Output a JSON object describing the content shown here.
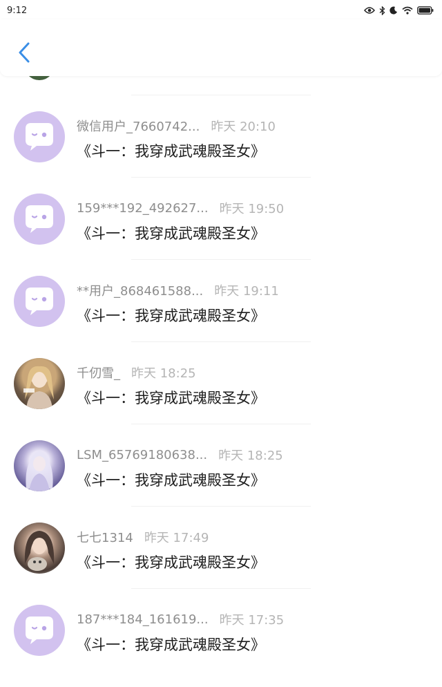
{
  "status_bar": {
    "time": "9:12",
    "icons": [
      "eye-icon",
      "bluetooth-icon",
      "moon-icon",
      "wifi-icon",
      "battery-icon"
    ]
  },
  "header": {
    "back_icon": "chevron-left-icon"
  },
  "messages": [
    {
      "name": "微信用户_7660742...",
      "time": "昨天 20:10",
      "text": "《斗一：我穿成武魂殿圣女》",
      "avatar": "default"
    },
    {
      "name": "159***192_492627...",
      "time": "昨天 19:50",
      "text": "《斗一：我穿成武魂殿圣女》",
      "avatar": "default"
    },
    {
      "name": "**用户_868461588...",
      "time": "昨天 19:11",
      "text": "《斗一：我穿成武魂殿圣女》",
      "avatar": "default"
    },
    {
      "name": "千仞雪_",
      "time": "昨天 18:25",
      "text": "《斗一：我穿成武魂殿圣女》",
      "avatar": "photo"
    },
    {
      "name": "LSM_65769180638...",
      "time": "昨天 18:25",
      "text": "《斗一：我穿成武魂殿圣女》",
      "avatar": "photo"
    },
    {
      "name": "七七1314",
      "time": "昨天 17:49",
      "text": "《斗一：我穿成武魂殿圣女》",
      "avatar": "photo"
    },
    {
      "name": "187***184_161619...",
      "time": "昨天 17:35",
      "text": "《斗一：我穿成武魂殿圣女》",
      "avatar": "default"
    }
  ],
  "colors": {
    "default_avatar": "#d2c2ef",
    "accent": "#3a8ee6"
  }
}
